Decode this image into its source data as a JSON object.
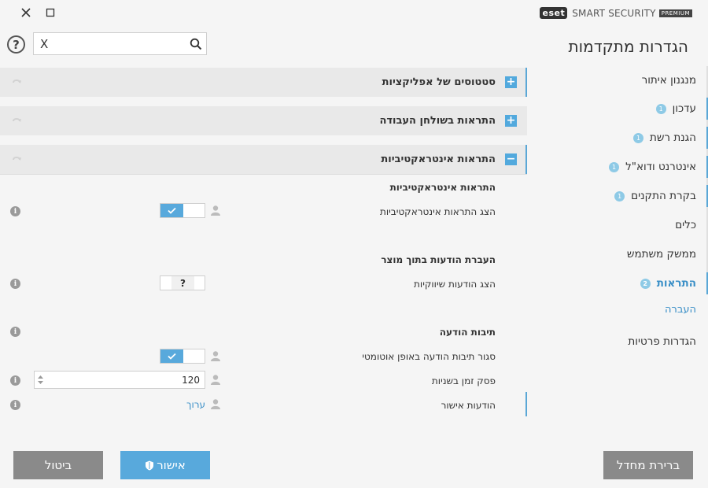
{
  "window": {
    "logo": {
      "brand": "eset",
      "product": "SMART SECURITY",
      "edition": "PREMIUM"
    }
  },
  "search": {
    "value": "",
    "clear_symbol": "X",
    "help_symbol": "?"
  },
  "sidebar": {
    "title": "הגדרות מתקדמות",
    "items": [
      {
        "label": "מנגנון איתור",
        "badge": ""
      },
      {
        "label": "עדכון",
        "badge": "1"
      },
      {
        "label": "הגנת רשת",
        "badge": "1"
      },
      {
        "label": "אינטרנט ודוא\"ל",
        "badge": "1"
      },
      {
        "label": "בקרת התקנים",
        "badge": "1"
      },
      {
        "label": "כלים",
        "badge": ""
      },
      {
        "label": "ממשק משתמש",
        "badge": ""
      },
      {
        "label": "התראות",
        "badge": "2"
      },
      {
        "label": "העברה",
        "badge": ""
      },
      {
        "label": "הגדרות פרטיות",
        "badge": ""
      }
    ]
  },
  "sections": [
    {
      "title": "סטטוסים של אפליקציות",
      "toggle": "+"
    },
    {
      "title": "התראות בשולחן העבודה",
      "toggle": "+"
    },
    {
      "title": "התראות אינטראקטיביות",
      "toggle": "−"
    }
  ],
  "content": {
    "group1_title": "התראות אינטראקטיביות",
    "show_interactive_label": "הצג התראות אינטראקטיביות",
    "group2_title": "העברת הודעות בתוך מוצר",
    "show_marketing_label": "הצג הודעות שיווקיות",
    "marketing_state": "?",
    "group3_title": "תיבות הודעה",
    "auto_close_label": "סגור תיבות הודעה באופן אוטומטי",
    "timeout_label": "פסק זמן בשניות",
    "timeout_value": "120",
    "confirm_label": "הודעות אישור",
    "edit_link": "ערוך"
  },
  "buttons": {
    "default": "ברירת מחדל",
    "ok": "אישור",
    "cancel": "ביטול"
  },
  "colors": {
    "accent": "#58a9dc",
    "badge": "#8ecae6",
    "button_gray": "#8a8a8a"
  }
}
